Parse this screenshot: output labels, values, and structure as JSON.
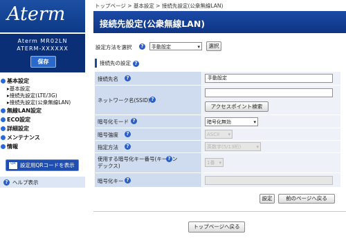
{
  "sidebar": {
    "logo": "Aterm",
    "model_name": "Aterm MR02LN",
    "model_id": "ATERM-XXXXXX",
    "save_label": "保存",
    "nav": [
      {
        "label": "基本設定",
        "subs": [
          "基本設定",
          "接続先設定(LTE/3G)",
          "接続先設定(公衆無線LAN)"
        ]
      },
      {
        "label": "無線LAN設定"
      },
      {
        "label": "ECO設定"
      },
      {
        "label": "詳細設定"
      },
      {
        "label": "メンテナンス"
      },
      {
        "label": "情報"
      }
    ],
    "qr_icon_text": "QR",
    "qr_label": "設定用QRコードを表示",
    "help_label": "ヘルプ表示"
  },
  "main": {
    "breadcrumb": "トップページ > 基本設定 > 接続先設定(公衆無線LAN)",
    "title": "接続先設定(公衆無線LAN)",
    "method_label": "設定方法を選択",
    "method_value": "手動設定",
    "select_button": "選択",
    "section_title": "接続先の設定",
    "fields": {
      "connection_name_label": "接続先名",
      "connection_name_value": "手動設定",
      "ssid_label": "ネットワーク名(SSID)",
      "ssid_value": "",
      "ap_search_button": "アクセスポイント検索",
      "encryption_mode_label": "暗号化モード",
      "encryption_mode_value": "暗号化無効",
      "encryption_strength_label": "暗号強度",
      "encryption_strength_value": "ASCII",
      "method_label": "指定方法",
      "method_value": "英数字(5/13桁)",
      "key_index_label": "使用する暗号化キー番号(キーインデックス)",
      "key_index_value": "1番",
      "key_label": "暗号化キー",
      "key_value": ""
    },
    "set_button": "設定",
    "back_button": "前のページへ戻る",
    "top_button": "トップページへ戻る",
    "help_glyph": "?"
  }
}
